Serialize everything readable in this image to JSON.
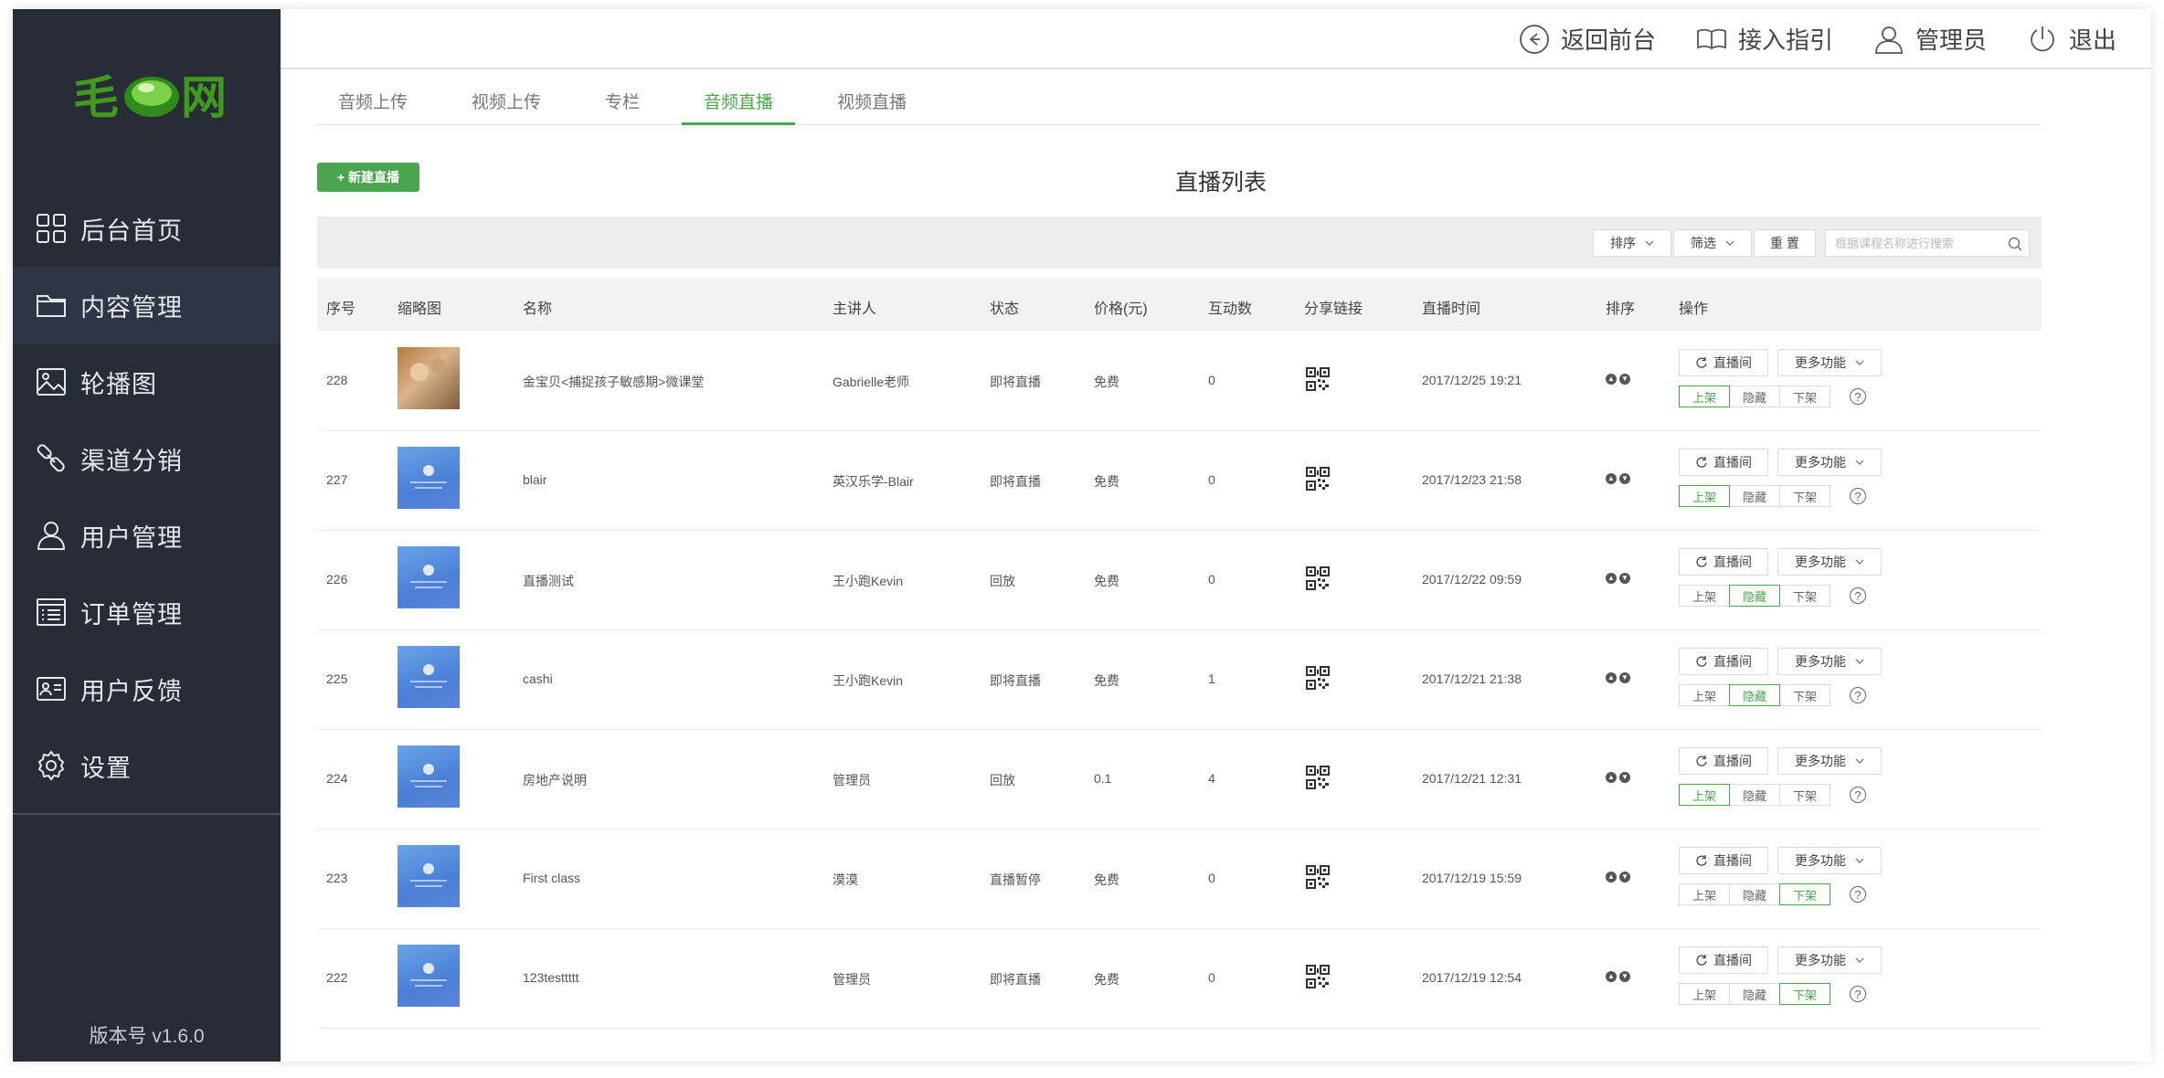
{
  "brand": {
    "logo_text": "毛豆网",
    "accent": "#4aa64e"
  },
  "sidebar": {
    "items": [
      {
        "label": "后台首页",
        "icon": "grid-icon"
      },
      {
        "label": "内容管理",
        "icon": "folder-icon",
        "active": true
      },
      {
        "label": "轮播图",
        "icon": "image-icon"
      },
      {
        "label": "渠道分销",
        "icon": "link-icon"
      },
      {
        "label": "用户管理",
        "icon": "user-icon"
      },
      {
        "label": "订单管理",
        "icon": "list-icon"
      },
      {
        "label": "用户反馈",
        "icon": "id-card-icon"
      },
      {
        "label": "设置",
        "icon": "gear-icon"
      }
    ],
    "version": "版本号 v1.6.0"
  },
  "header": {
    "back": "返回前台",
    "guide": "接入指引",
    "admin": "管理员",
    "logout": "退出"
  },
  "tabs": [
    {
      "label": "音频上传"
    },
    {
      "label": "视频上传"
    },
    {
      "label": "专栏"
    },
    {
      "label": "音频直播",
      "active": true
    },
    {
      "label": "视频直播"
    }
  ],
  "toolbar": {
    "new_label": "+ 新建直播",
    "title": "直播列表"
  },
  "filters": {
    "sort": "排序",
    "filter": "筛选",
    "reset": "重 置",
    "search_placeholder": "根据课程名称进行搜索"
  },
  "table": {
    "headers": {
      "id": "序号",
      "thumb": "缩略图",
      "name": "名称",
      "host": "主讲人",
      "status": "状态",
      "price": "价格(元)",
      "interactions": "互动数",
      "share": "分享链接",
      "time": "直播时间",
      "sort": "排序",
      "ops": "操作"
    },
    "ops": {
      "live": "直播间",
      "more": "更多功能",
      "up": "上架",
      "hide": "隐藏",
      "down": "下架",
      "help": "?"
    },
    "rows": [
      {
        "id": "228",
        "name": "金宝贝<捕捉孩子敏感期>微课堂",
        "host": "Gabrielle老师",
        "status": "即将直播",
        "price": "免费",
        "interactions": "0",
        "time": "2017/12/25 19:21",
        "thumb": "photo",
        "state": "up"
      },
      {
        "id": "227",
        "name": "blair",
        "host": "英汉乐学-Blair",
        "status": "即将直播",
        "price": "免费",
        "interactions": "0",
        "time": "2017/12/23 21:58",
        "thumb": "blue",
        "state": "up"
      },
      {
        "id": "226",
        "name": "直播测试",
        "host": "王小跑Kevin",
        "status": "回放",
        "price": "免费",
        "interactions": "0",
        "time": "2017/12/22 09:59",
        "thumb": "blue",
        "state": "hide"
      },
      {
        "id": "225",
        "name": "cashi",
        "host": "王小跑Kevin",
        "status": "即将直播",
        "price": "免费",
        "interactions": "1",
        "time": "2017/12/21 21:38",
        "thumb": "blue",
        "state": "hide"
      },
      {
        "id": "224",
        "name": "房地产说明",
        "host": "管理员",
        "status": "回放",
        "price": "0.1",
        "interactions": "4",
        "time": "2017/12/21 12:31",
        "thumb": "blue",
        "state": "up"
      },
      {
        "id": "223",
        "name": "First class",
        "host": "漠漠",
        "status": "直播暂停",
        "price": "免费",
        "interactions": "0",
        "time": "2017/12/19 15:59",
        "thumb": "blue",
        "state": "down"
      },
      {
        "id": "222",
        "name": "123testtttt",
        "host": "管理员",
        "status": "即将直播",
        "price": "免费",
        "interactions": "0",
        "time": "2017/12/19 12:54",
        "thumb": "blue",
        "state": "down"
      }
    ]
  }
}
